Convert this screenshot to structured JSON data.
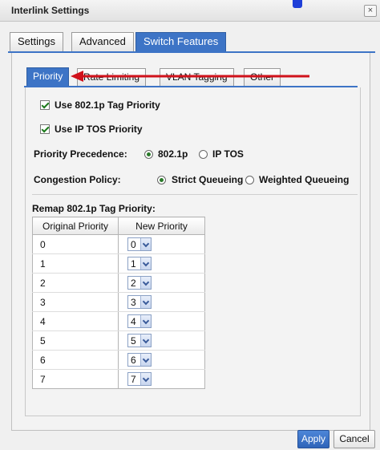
{
  "window": {
    "title": "Interlink Settings",
    "close_icon": "close-icon",
    "close_glyph": "×"
  },
  "top_tabs": [
    "Settings",
    "Advanced",
    "Switch Features"
  ],
  "active_top_tab": "Switch Features",
  "sub_tabs": [
    "Priority",
    "Rate Limiting",
    "VLAN Tagging",
    "Other"
  ],
  "active_sub_tab": "Priority",
  "options": {
    "use_8021p_label": "Use 802.1p Tag Priority",
    "use_8021p_checked": true,
    "use_ip_tos_label": "Use IP TOS Priority",
    "use_ip_tos_checked": true
  },
  "precedence": {
    "label": "Priority Precedence:",
    "choices": [
      "802.1p",
      "IP TOS"
    ],
    "selected": "802.1p"
  },
  "congestion": {
    "label": "Congestion Policy:",
    "choices": [
      "Strict Queueing",
      "Weighted Queueing"
    ],
    "selected": "Strict Queueing"
  },
  "remap": {
    "title": "Remap 802.1p Tag Priority:",
    "columns": [
      "Original Priority",
      "New Priority"
    ],
    "rows": [
      {
        "original": "0",
        "new": "0"
      },
      {
        "original": "1",
        "new": "1"
      },
      {
        "original": "2",
        "new": "2"
      },
      {
        "original": "3",
        "new": "3"
      },
      {
        "original": "4",
        "new": "4"
      },
      {
        "original": "5",
        "new": "5"
      },
      {
        "original": "6",
        "new": "6"
      },
      {
        "original": "7",
        "new": "7"
      }
    ]
  },
  "buttons": {
    "apply": "Apply",
    "cancel": "Cancel"
  },
  "colors": {
    "accent": "#3d74c6",
    "annotation_arrow": "#d0121b",
    "check": "#1b7a1b"
  }
}
